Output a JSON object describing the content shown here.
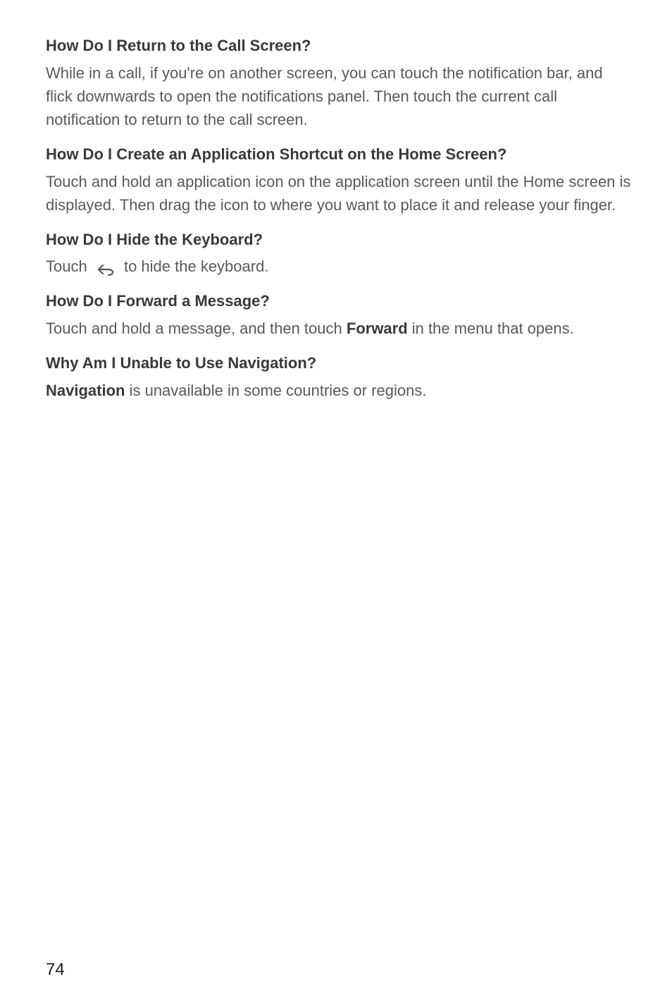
{
  "sections": {
    "return_call": {
      "heading": "How Do I Return to the Call Screen?",
      "body": "While in a call, if you're on another screen, you can touch the notification bar, and flick downwards to open the notifications panel. Then touch the current call notification to return to the call screen."
    },
    "shortcut": {
      "heading": "How Do I Create an Application Shortcut on the Home Screen?",
      "body": "Touch and hold an application icon on the application screen until the Home screen is displayed. Then drag the icon to where you want to place it and release your finger."
    },
    "hide_keyboard": {
      "heading": "How Do I Hide the Keyboard?",
      "body_prefix": "Touch ",
      "body_suffix": " to hide the keyboard."
    },
    "forward_message": {
      "heading": "How Do I Forward a Message?",
      "body_prefix": "Touch and hold a message, and then touch ",
      "body_bold": "Forward",
      "body_suffix": " in the menu that opens."
    },
    "navigation": {
      "heading": "Why Am I Unable to Use Navigation?",
      "body_bold": "Navigation",
      "body_suffix": " is unavailable in some countries or regions."
    }
  },
  "page_number": "74"
}
